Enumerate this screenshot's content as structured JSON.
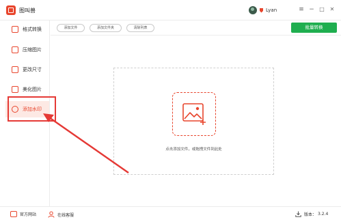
{
  "app": {
    "title": "图叫兽"
  },
  "user": {
    "name": "Lyan"
  },
  "window_controls": {
    "menu": "≡",
    "minimize": "−",
    "maximize": "□",
    "close": "✕"
  },
  "sidebar": {
    "items": [
      {
        "label": "格式转换",
        "icon": "format-convert-icon"
      },
      {
        "label": "压缩图片",
        "icon": "compress-icon"
      },
      {
        "label": "更改尺寸",
        "icon": "resize-icon"
      },
      {
        "label": "美化图片",
        "icon": "beautify-icon"
      },
      {
        "label": "添加水印",
        "icon": "watermark-icon",
        "active": true
      }
    ]
  },
  "toolbar": {
    "add_file": "添加文件",
    "add_folder": "添加文件夹",
    "clear_list": "清除列表",
    "batch_convert": "批量转换"
  },
  "dropzone": {
    "hint": "点击添加文件，或拖拽文件到此处",
    "icon": "image-add-icon"
  },
  "footer": {
    "website": "官方网站",
    "support": "在线客服",
    "version_label": "版本：",
    "version_value": "3.2.4"
  },
  "colors": {
    "accent": "#e8452c",
    "batch_button": "#1fae4f",
    "annotation": "#e53935"
  }
}
